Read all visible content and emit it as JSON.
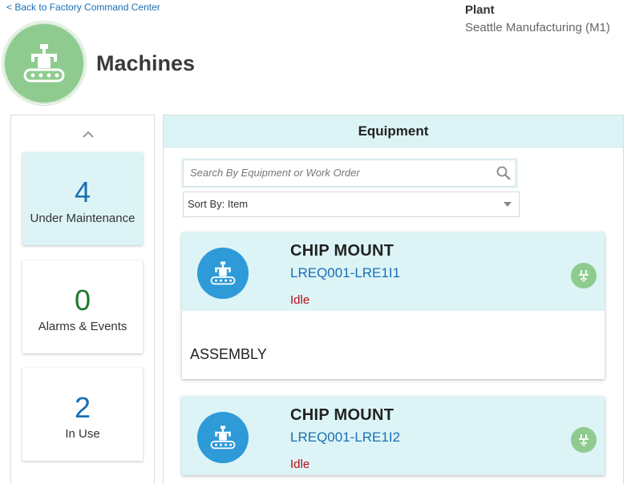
{
  "nav": {
    "back_label": "< Back to Factory Command Center"
  },
  "plant": {
    "title": "Plant",
    "name": "Seattle Manufacturing (M1)"
  },
  "page": {
    "title": "Machines",
    "icon": "machine-conveyor-icon",
    "icon_bg": "#8fcb8f"
  },
  "metrics": [
    {
      "value": "4",
      "label": "Under Maintenance",
      "color": "#1a6fb3",
      "active": true
    },
    {
      "value": "0",
      "label": "Alarms & Events",
      "color": "#1e7a2e",
      "active": false
    },
    {
      "value": "2",
      "label": "In Use",
      "color": "#1a6fb3",
      "active": false
    }
  ],
  "equipment_panel": {
    "title": "Equipment",
    "search": {
      "placeholder": "Search By Equipment or Work Order",
      "value": ""
    },
    "sort": {
      "label": "Sort By: Item"
    }
  },
  "equipment": [
    {
      "name": "CHIP MOUNT",
      "id": "LREQ001-LRE1I1",
      "status": "Idle",
      "department": "ASSEMBLY",
      "status_color": "#b0101a",
      "badge_icon": "ground-plug-icon"
    },
    {
      "name": "CHIP MOUNT",
      "id": "LREQ001-LRE1I2",
      "status": "Idle",
      "department": "",
      "status_color": "#b0101a",
      "badge_icon": "ground-plug-icon"
    }
  ],
  "colors": {
    "accent_blue": "#2e9ad8",
    "header_tint": "#dcf4f6",
    "link": "#1a6fb3"
  }
}
